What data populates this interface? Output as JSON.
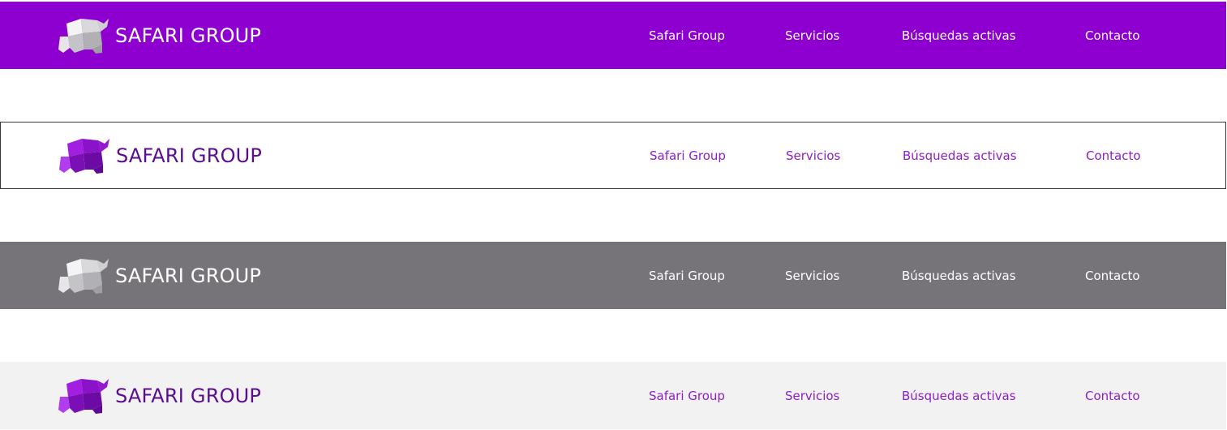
{
  "variants": [
    {
      "background": "#8e00cf",
      "brand_color": "#ffffff",
      "link_color": "#ffffff",
      "logo_style": "silver",
      "brand": {
        "name": "SAFARI GROUP",
        "logo_icon": "origami-elephant-icon"
      },
      "nav": [
        {
          "label": "Safari Group"
        },
        {
          "label": "Servicios"
        },
        {
          "label": "Búsquedas activas"
        },
        {
          "label": "Contacto"
        }
      ]
    },
    {
      "background": "#ffffff",
      "brand_color": "#5a0d8f",
      "link_color": "#8e1fc7",
      "logo_style": "purple",
      "brand": {
        "name": "SAFARI GROUP",
        "logo_icon": "origami-elephant-icon"
      },
      "nav": [
        {
          "label": "Safari Group"
        },
        {
          "label": "Servicios"
        },
        {
          "label": "Búsquedas activas"
        },
        {
          "label": "Contacto"
        }
      ]
    },
    {
      "background": "#767479",
      "brand_color": "#ffffff",
      "link_color": "#ffffff",
      "logo_style": "silver",
      "brand": {
        "name": "SAFARI GROUP",
        "logo_icon": "origami-elephant-icon"
      },
      "nav": [
        {
          "label": "Safari Group"
        },
        {
          "label": "Servicios"
        },
        {
          "label": "Búsquedas activas"
        },
        {
          "label": "Contacto"
        }
      ]
    },
    {
      "background": "#f2f2f2",
      "brand_color": "#5a0d8f",
      "link_color": "#8e1fc7",
      "logo_style": "purple",
      "brand": {
        "name": "SAFARI GROUP",
        "logo_icon": "origami-elephant-icon"
      },
      "nav": [
        {
          "label": "Safari Group"
        },
        {
          "label": "Servicios"
        },
        {
          "label": "Búsquedas activas"
        },
        {
          "label": "Contacto"
        }
      ]
    }
  ]
}
